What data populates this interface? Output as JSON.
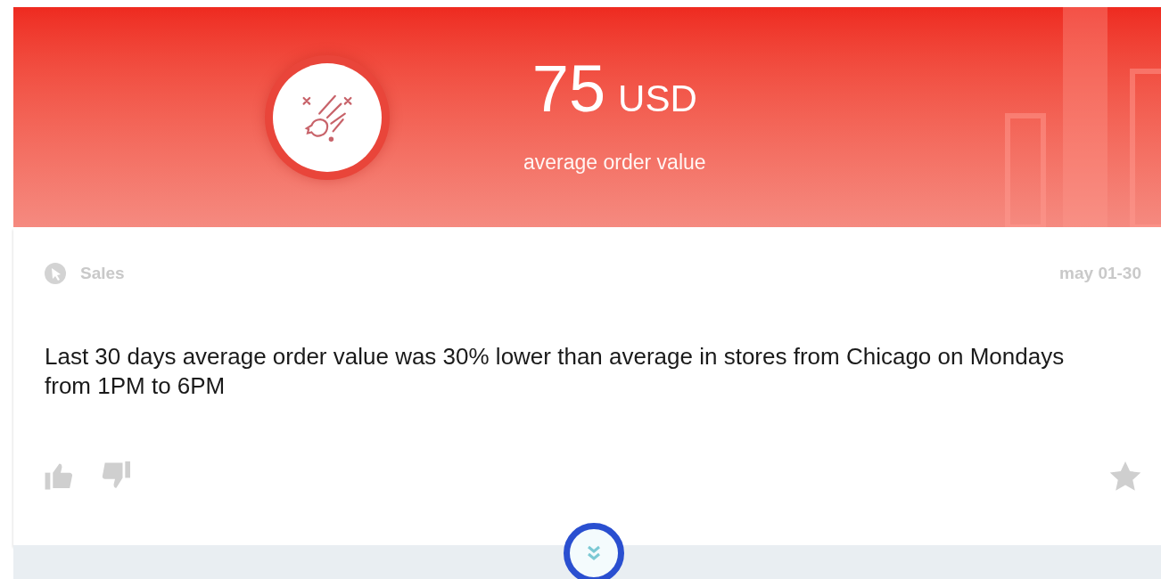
{
  "metric": {
    "value": "75",
    "unit": "USD",
    "caption": "average order value"
  },
  "source": {
    "label": "Sales",
    "date": "may 01-30"
  },
  "message": "Last 30 days average order value was 30% lower than average in stores from Chicago on Mondays from 1PM to 6PM"
}
